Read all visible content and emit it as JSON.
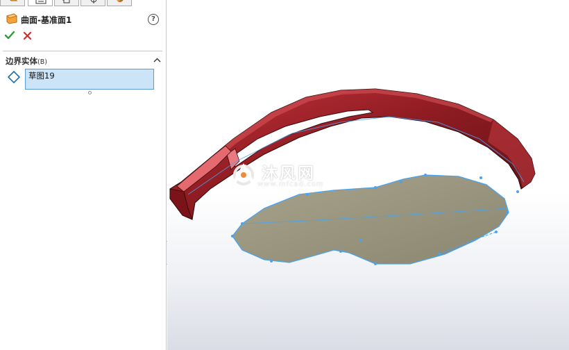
{
  "feature": {
    "title": "曲面-基准面1",
    "help": "?"
  },
  "tabs": [
    {
      "name": "feature-manager",
      "icon": "feature-tree-icon"
    },
    {
      "name": "property-manager",
      "icon": "property-list-icon",
      "active": true
    },
    {
      "name": "configuration-manager",
      "icon": "configuration-icon"
    },
    {
      "name": "dimxpert-manager",
      "icon": "crosshair-icon"
    },
    {
      "name": "display-manager",
      "icon": "appearance-icon"
    }
  ],
  "actions": {
    "ok_icon": "check-icon",
    "cancel_icon": "x-icon"
  },
  "boundary_section": {
    "title": "边界实体",
    "suffix": "(B)",
    "items": [
      "草图19"
    ]
  },
  "watermark": {
    "main": "沐风网",
    "url": "www.mfcad.com"
  },
  "colors": {
    "selection_fill": "#cce4f7",
    "selection_border": "#5a9bd5",
    "model_red": "#8b1a1e",
    "surface_fill": "#9b9781",
    "sketch_blue": "#4aa3f0",
    "ok_green": "#2e9a3a",
    "cancel_red": "#d62b2b"
  }
}
